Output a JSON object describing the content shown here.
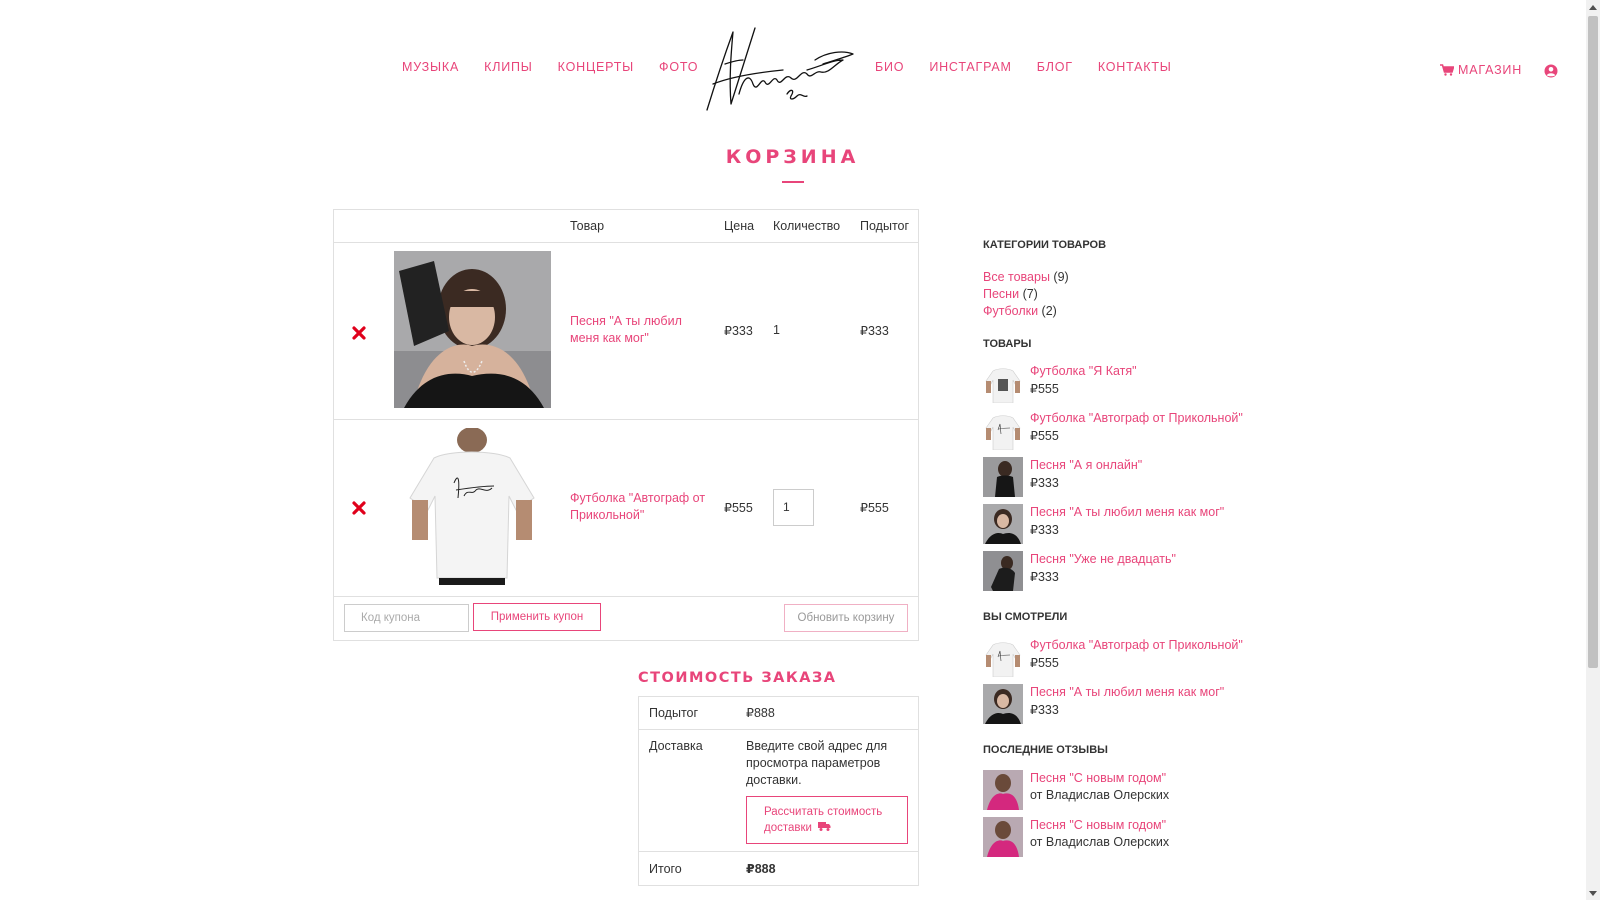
{
  "nav": {
    "left": [
      "МУЗЫКА",
      "КЛИПЫ",
      "КОНЦЕРТЫ",
      "ФОТО"
    ],
    "right": [
      "БИО",
      "ИНСТАГРАМ",
      "БЛОГ",
      "КОНТАКТЫ"
    ],
    "shop_label": "МАГАЗИН"
  },
  "page_title": "КОРЗИНА",
  "cart": {
    "headers": {
      "product": "Товар",
      "price": "Цена",
      "quantity": "Количество",
      "subtotal": "Подытог"
    },
    "items": [
      {
        "name": "Песня \"А ты любил меня как мог\"",
        "price": "₽333",
        "quantity": "1",
        "subtotal": "₽333"
      },
      {
        "name": "Футболка \"Автограф от Прикольной\"",
        "price": "₽555",
        "quantity": "1",
        "subtotal": "₽555"
      }
    ],
    "coupon_placeholder": "Код купона",
    "apply_coupon": "Применить купон",
    "update_cart": "Обновить корзину"
  },
  "totals": {
    "title": "СТОИМОСТЬ ЗАКАЗА",
    "subtotal_label": "Подытог",
    "subtotal_value": "₽888",
    "shipping_label": "Доставка",
    "shipping_text": "Введите свой адрес для просмотра параметров доставки.",
    "calc_shipping": "Рассчитать стоимость доставки",
    "total_label": "Итого",
    "total_value": "₽888"
  },
  "sidebar": {
    "categories_heading": "КАТЕГОРИИ ТОВАРОВ",
    "categories": [
      {
        "name": "Все товары",
        "count": "(9)"
      },
      {
        "name": "Песни",
        "count": "(7)"
      },
      {
        "name": "Футболки",
        "count": "(2)"
      }
    ],
    "products_heading": "ТОВАРЫ",
    "products": [
      {
        "title": "Футболка \"Я Катя\"",
        "price": "₽555"
      },
      {
        "title": "Футболка \"Автограф от Прикольной\"",
        "price": "₽555"
      },
      {
        "title": "Песня \"А я онлайн\"",
        "price": "₽333"
      },
      {
        "title": "Песня \"А ты любил меня как мог\"",
        "price": "₽333"
      },
      {
        "title": "Песня \"Уже не двадцать\"",
        "price": "₽333"
      }
    ],
    "viewed_heading": "ВЫ СМОТРЕЛИ",
    "viewed": [
      {
        "title": "Футболка \"Автограф от Прикольной\"",
        "price": "₽555"
      },
      {
        "title": "Песня \"А ты любил меня как мог\"",
        "price": "₽333"
      }
    ],
    "reviews_heading": "ПОСЛЕДНИЕ ОТЗЫВЫ",
    "reviews": [
      {
        "title": "Песня \"С новым годом\"",
        "author": "от Владислав Олерских"
      },
      {
        "title": "Песня \"С новым годом\"",
        "author": "от Владислав Олерских"
      }
    ]
  },
  "colors": {
    "accent": "#e8457a",
    "remove": "#e0001b",
    "border": "#e0e0e0"
  }
}
